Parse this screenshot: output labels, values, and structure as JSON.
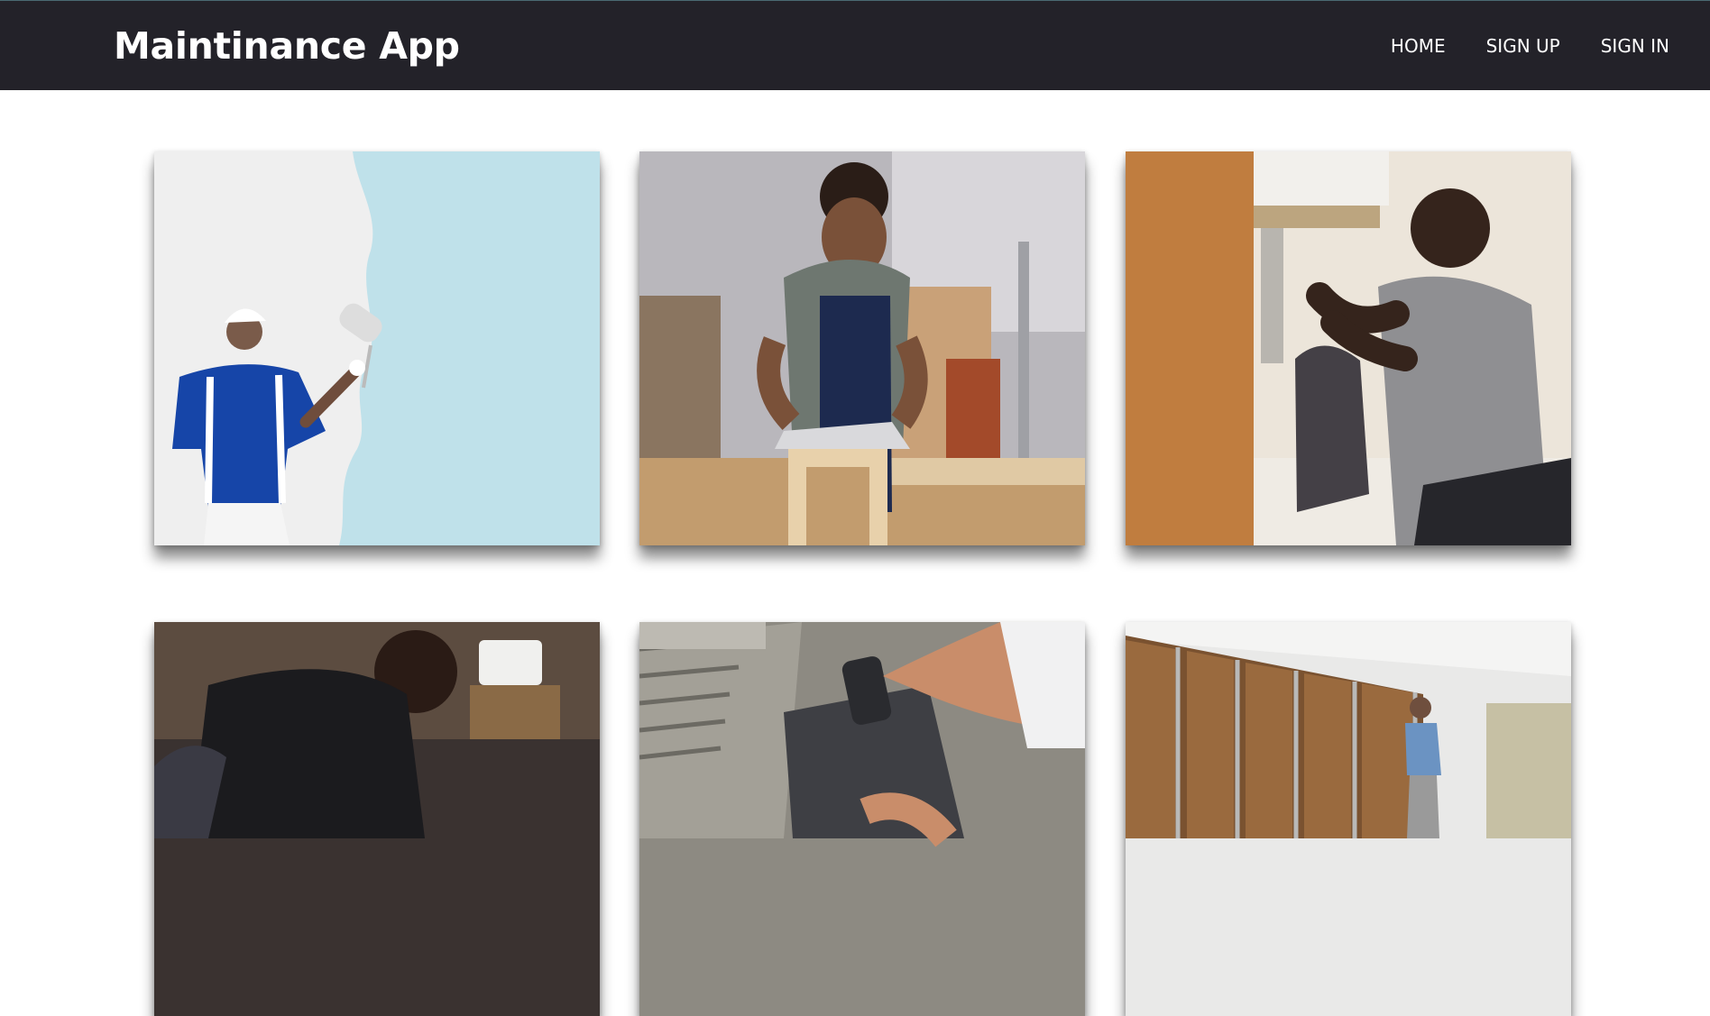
{
  "app": {
    "title": "Maintinance App"
  },
  "nav": {
    "home": "HOME",
    "signup": "SIGN UP",
    "signin": "SIGN IN"
  },
  "colors": {
    "navbar": "#232229",
    "text": "#ffffff",
    "background": "#ffffff"
  },
  "gallery": [
    {
      "subject": "painter-rolling-light-blue-wall"
    },
    {
      "subject": "carpenter-planing-wood"
    },
    {
      "subject": "plumber-fixing-sink-pipes"
    },
    {
      "subject": "worker-in-workshop"
    },
    {
      "subject": "tile-setter-hammering-tile"
    },
    {
      "subject": "worker-installing-wall-insulation"
    }
  ]
}
